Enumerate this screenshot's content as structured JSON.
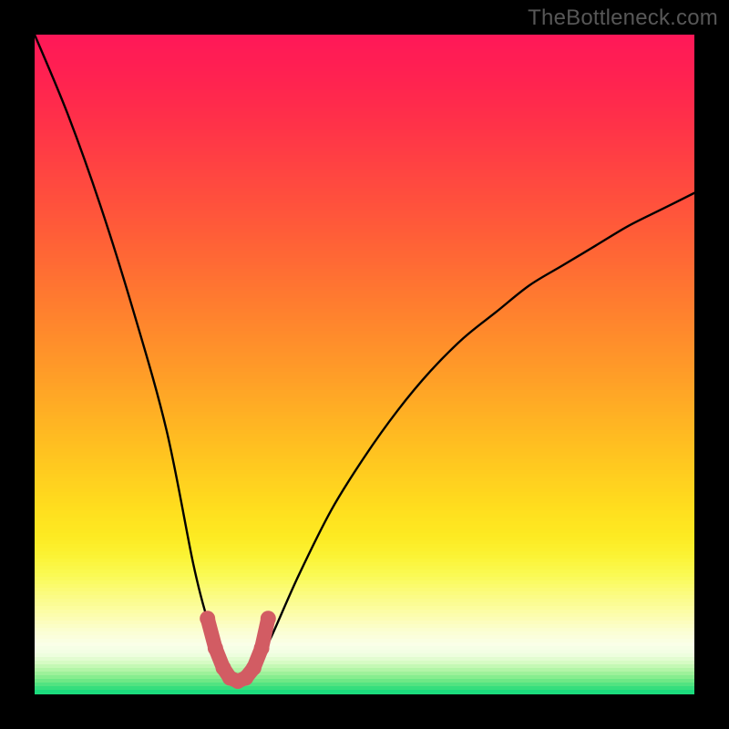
{
  "watermark": {
    "text": "TheBottleneck.com"
  },
  "chart_data": {
    "type": "line",
    "title": "",
    "xlabel": "",
    "ylabel": "",
    "x_range": [
      0,
      100
    ],
    "y_range": [
      0,
      100
    ],
    "series": [
      {
        "name": "bottleneck-curve",
        "x": [
          0,
          5,
          10,
          15,
          20,
          24,
          26,
          28,
          29,
          30,
          31,
          32,
          33,
          34,
          36,
          40,
          45,
          50,
          55,
          60,
          65,
          70,
          75,
          80,
          85,
          90,
          95,
          100
        ],
        "y": [
          100,
          88,
          74,
          58,
          40,
          20,
          12,
          6,
          3,
          2,
          2,
          2,
          3,
          5,
          9,
          18,
          28,
          36,
          43,
          49,
          54,
          58,
          62,
          65,
          68,
          71,
          73.5,
          76
        ]
      }
    ],
    "highlight_segment": {
      "name": "bottom-marker",
      "color": "#d25c63",
      "x": [
        26.2,
        27.4,
        28.6,
        29.6,
        30.8,
        32.0,
        33.2,
        34.4,
        35.4
      ],
      "y": [
        11.5,
        7.0,
        4.0,
        2.5,
        2.0,
        2.5,
        4.0,
        7.0,
        11.5
      ]
    },
    "background_gradient_stops": [
      {
        "pct": 0.0,
        "color": "#ff1858"
      },
      {
        "pct": 0.06,
        "color": "#ff2151"
      },
      {
        "pct": 0.12,
        "color": "#ff2e4a"
      },
      {
        "pct": 0.18,
        "color": "#ff3d44"
      },
      {
        "pct": 0.24,
        "color": "#ff4d3e"
      },
      {
        "pct": 0.3,
        "color": "#ff5d38"
      },
      {
        "pct": 0.36,
        "color": "#ff6e33"
      },
      {
        "pct": 0.42,
        "color": "#ff802e"
      },
      {
        "pct": 0.48,
        "color": "#ff922a"
      },
      {
        "pct": 0.54,
        "color": "#ffa526"
      },
      {
        "pct": 0.6,
        "color": "#ffb822"
      },
      {
        "pct": 0.66,
        "color": "#ffcb1f"
      },
      {
        "pct": 0.72,
        "color": "#ffde1e"
      },
      {
        "pct": 0.76,
        "color": "#fdea22"
      },
      {
        "pct": 0.79,
        "color": "#fbf334"
      },
      {
        "pct": 0.82,
        "color": "#fafa55"
      },
      {
        "pct": 0.85,
        "color": "#fbfc82"
      },
      {
        "pct": 0.88,
        "color": "#fcfdac"
      },
      {
        "pct": 0.905,
        "color": "#fbfed2"
      },
      {
        "pct": 0.925,
        "color": "#faffe8"
      },
      {
        "pct": 0.94,
        "color": "#f0fee2"
      },
      {
        "pct": 0.952,
        "color": "#d8fbc6"
      },
      {
        "pct": 0.962,
        "color": "#b9f6ab"
      },
      {
        "pct": 0.972,
        "color": "#94ef94"
      },
      {
        "pct": 0.982,
        "color": "#67e784"
      },
      {
        "pct": 0.992,
        "color": "#34de7d"
      },
      {
        "pct": 1.0,
        "color": "#10d97d"
      }
    ]
  }
}
